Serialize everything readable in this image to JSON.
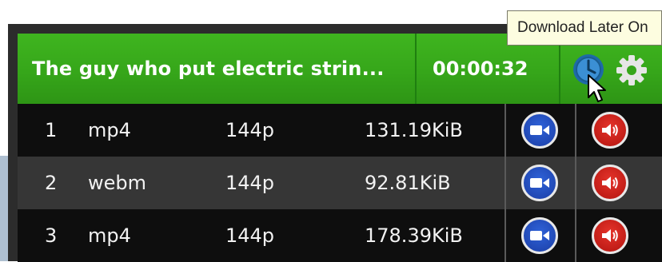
{
  "header": {
    "title": "The guy who put electric strin...",
    "duration": "00:00:32"
  },
  "tooltip": {
    "text": "Download Later On"
  },
  "rows": [
    {
      "index": "1",
      "format": "mp4",
      "resolution": "144p",
      "size": "131.19KiB"
    },
    {
      "index": "2",
      "format": "webm",
      "resolution": "144p",
      "size": "92.81KiB"
    },
    {
      "index": "3",
      "format": "mp4",
      "resolution": "144p",
      "size": "178.39KiB"
    }
  ],
  "icons": {
    "clock": "clock-icon",
    "settings": "gear-icon",
    "video": "video-camera-icon",
    "audio": "speaker-icon",
    "cursor": "mouse-cursor-icon"
  },
  "colors": {
    "header_green": "#36a61a",
    "video_blue": "#1b3ea6",
    "audio_red": "#b3140f",
    "row_dark": "#0e0e0e",
    "row_alt": "#363636",
    "tooltip_bg": "#fdfde0"
  }
}
